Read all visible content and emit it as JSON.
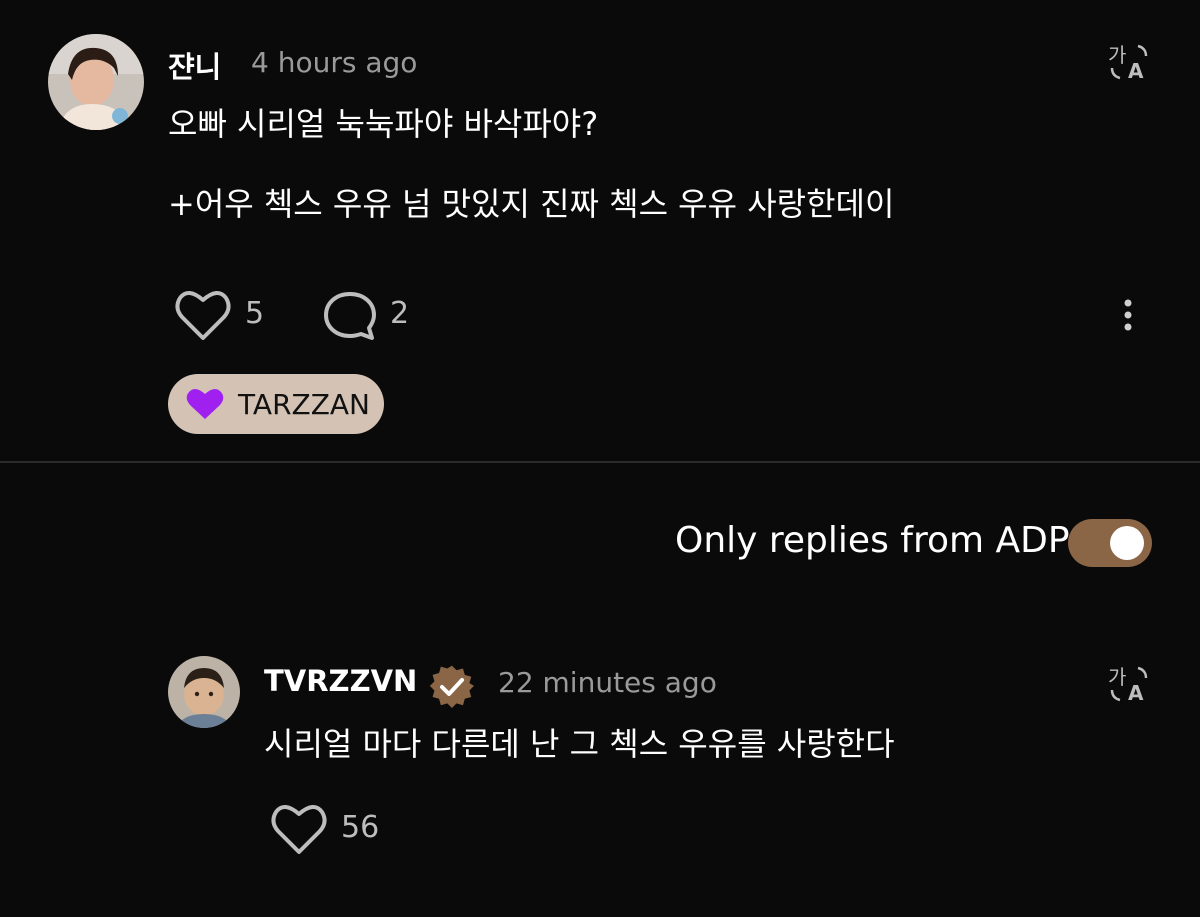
{
  "comment": {
    "author": "쟌니",
    "time": "4 hours ago",
    "text": "오빠 시리얼 눅눅파야 바삭파야?\n\n+어우 첵스 우유 넘 맛있지 진짜 첵스 우유 사랑한데이",
    "likes": "5",
    "replies": "2",
    "translate_icon": "translate-icon",
    "tag": {
      "label": "TARZZAN",
      "icon": "heart-icon",
      "icon_color": "#a020f0",
      "bg_color": "#d4c3b4"
    }
  },
  "filter": {
    "label": "Only replies from ADP",
    "toggle_on": true,
    "toggle_color": "#8a6646"
  },
  "reply": {
    "author": "TVRZZVN",
    "verified_badge": "verified-badge-icon",
    "badge_color": "#8a6646",
    "time": "22 minutes ago",
    "text": "시리얼 마다 다른데 난 그 첵스 우유를 사랑한다",
    "likes": "56",
    "translate_icon": "translate-icon"
  }
}
